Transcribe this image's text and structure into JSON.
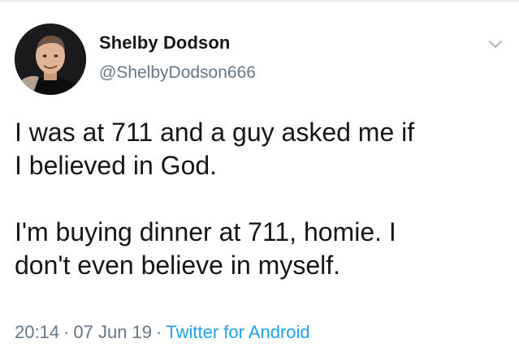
{
  "author": {
    "display_name": "Shelby Dodson",
    "handle": "@ShelbyDodson666"
  },
  "tweet": {
    "lines": [
      "I was at 711 and a guy asked me if",
      "I believed in God.",
      "I'm buying dinner at 711, homie. I",
      "don't even believe in myself."
    ]
  },
  "meta": {
    "time": "20:14",
    "separator": "·",
    "date": "07 Jun 19",
    "source": "Twitter for Android"
  },
  "icons": {
    "avatar": "profile-photo",
    "caret": "chevron-down-icon"
  },
  "colors": {
    "text": "#14171a",
    "secondary": "#657786",
    "link": "#1da1f2",
    "caret": "#aab8c2"
  }
}
